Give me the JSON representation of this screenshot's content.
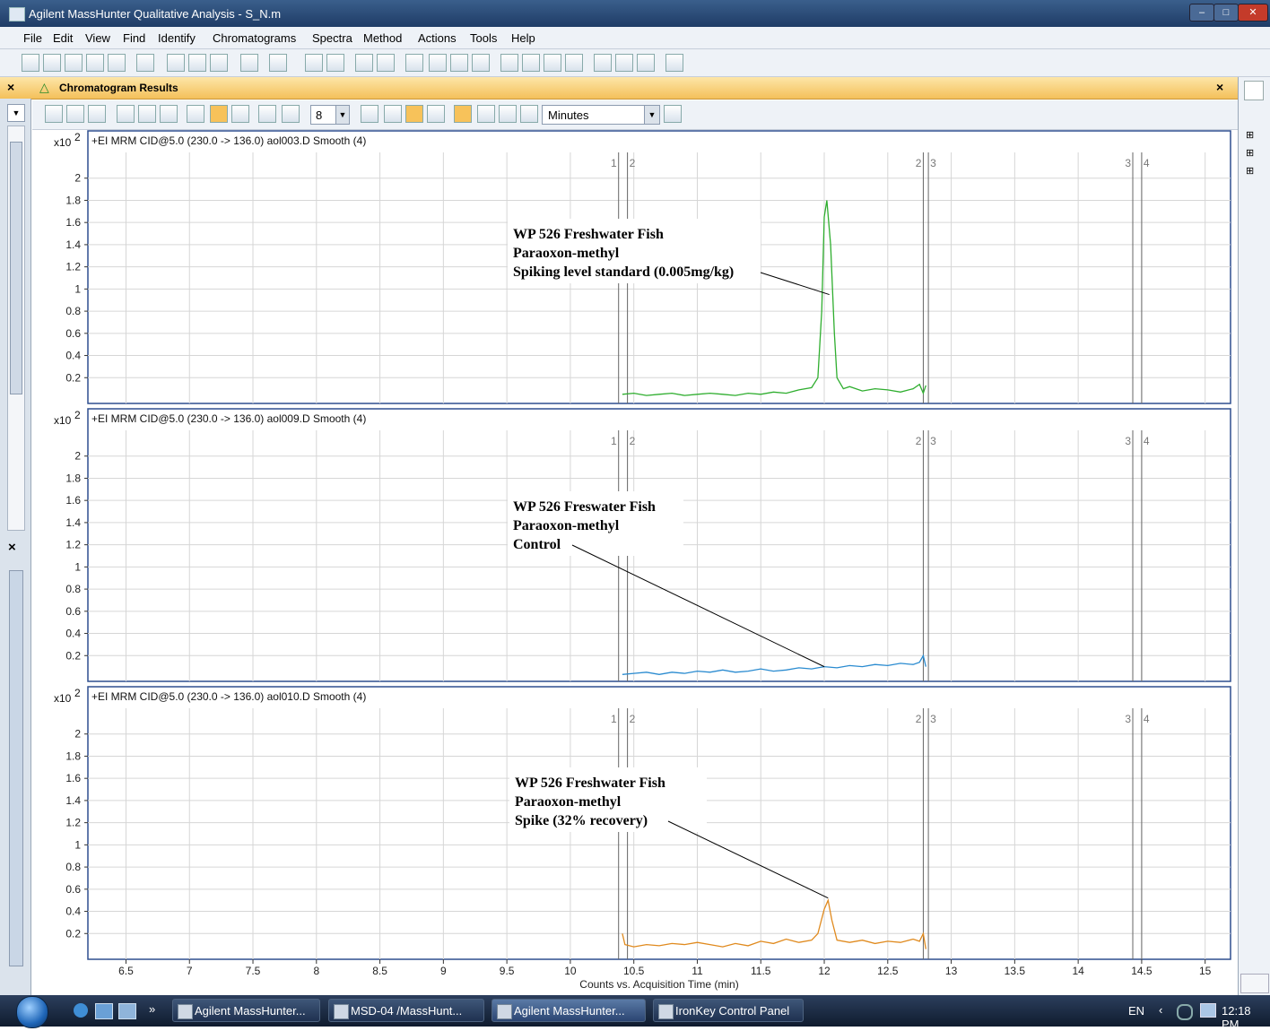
{
  "window": {
    "title": "Agilent MassHunter Qualitative Analysis - S_N.m"
  },
  "menu": [
    "File",
    "Edit",
    "View",
    "Find",
    "Identify",
    "Chromatograms",
    "Spectra",
    "Method",
    "Actions",
    "Tools",
    "Help"
  ],
  "panel": {
    "title": "Chromatogram Results",
    "close": "×"
  },
  "toolbar": {
    "smoothing_value": "8",
    "units": "Minutes"
  },
  "colors": {
    "green": "#2fae2f",
    "blue": "#2a8bd0",
    "orange": "#e08a1e",
    "border": "#2f4f8f"
  },
  "chart_data": [
    {
      "type": "line",
      "scale_label": "x10",
      "scale_exp": "2",
      "title": "+EI MRM CID@5.0 (230.0 -> 136.0) aol003.D  Smooth (4)",
      "ylim": [
        0,
        2.2
      ],
      "yticks": [
        2,
        1.8,
        1.6,
        1.4,
        1.2,
        1,
        0.8,
        0.6,
        0.4,
        0.2
      ],
      "segments": [
        "1",
        "2",
        "2",
        "3",
        "3",
        "4"
      ],
      "annotation": [
        "WP 526 Freshwater Fish",
        "Paraoxon-methyl",
        "Spiking level standard (0.005mg/kg)"
      ],
      "color": "#2fae2f",
      "series": [
        {
          "x": [
            10.41,
            10.5,
            10.6,
            10.7,
            10.8,
            10.9,
            11.0,
            11.1,
            11.2,
            11.3,
            11.4,
            11.5,
            11.6,
            11.7,
            11.8,
            11.9,
            11.95,
            11.98,
            12.0,
            12.02,
            12.05,
            12.08,
            12.1,
            12.15,
            12.2,
            12.3,
            12.4,
            12.5,
            12.6,
            12.7,
            12.75,
            12.78,
            12.8
          ],
          "y": [
            0.05,
            0.06,
            0.04,
            0.05,
            0.06,
            0.04,
            0.05,
            0.06,
            0.05,
            0.04,
            0.06,
            0.05,
            0.07,
            0.06,
            0.09,
            0.11,
            0.2,
            0.8,
            1.65,
            1.8,
            1.4,
            0.6,
            0.2,
            0.1,
            0.12,
            0.08,
            0.1,
            0.09,
            0.07,
            0.1,
            0.14,
            0.06,
            0.13
          ]
        }
      ]
    },
    {
      "type": "line",
      "scale_label": "x10",
      "scale_exp": "2",
      "title": "+EI MRM CID@5.0 (230.0 -> 136.0) aol009.D  Smooth (4)",
      "ylim": [
        0,
        2.2
      ],
      "yticks": [
        2,
        1.8,
        1.6,
        1.4,
        1.2,
        1,
        0.8,
        0.6,
        0.4,
        0.2
      ],
      "segments": [
        "1",
        "2",
        "2",
        "3",
        "3",
        "4"
      ],
      "annotation": [
        "WP 526 Freswater Fish",
        "Paraoxon-methyl",
        "Control"
      ],
      "color": "#2a8bd0",
      "series": [
        {
          "x": [
            10.41,
            10.5,
            10.6,
            10.7,
            10.8,
            10.9,
            11.0,
            11.1,
            11.2,
            11.3,
            11.4,
            11.5,
            11.6,
            11.7,
            11.8,
            11.9,
            12.0,
            12.1,
            12.2,
            12.3,
            12.4,
            12.5,
            12.6,
            12.7,
            12.75,
            12.78,
            12.8
          ],
          "y": [
            0.03,
            0.04,
            0.05,
            0.03,
            0.05,
            0.04,
            0.06,
            0.05,
            0.07,
            0.05,
            0.06,
            0.08,
            0.06,
            0.07,
            0.09,
            0.08,
            0.1,
            0.09,
            0.11,
            0.1,
            0.12,
            0.11,
            0.13,
            0.12,
            0.14,
            0.2,
            0.1
          ]
        }
      ]
    },
    {
      "type": "line",
      "scale_label": "x10",
      "scale_exp": "2",
      "title": "+EI MRM CID@5.0 (230.0 -> 136.0) aol010.D  Smooth (4)",
      "ylim": [
        0,
        2.2
      ],
      "yticks": [
        2,
        1.8,
        1.6,
        1.4,
        1.2,
        1,
        0.8,
        0.6,
        0.4,
        0.2
      ],
      "segments": [
        "1",
        "2",
        "2",
        "3",
        "3",
        "4"
      ],
      "annotation": [
        "WP 526 Freshwater Fish",
        "Paraoxon-methyl",
        "Spike (32% recovery)"
      ],
      "color": "#e08a1e",
      "xticks": [
        6.5,
        7,
        7.5,
        8,
        8.5,
        9,
        9.5,
        10,
        10.5,
        11,
        11.5,
        12,
        12.5,
        13,
        13.5,
        14,
        14.5,
        15
      ],
      "xlabel": "Counts vs. Acquisition Time (min)",
      "series": [
        {
          "x": [
            10.41,
            10.43,
            10.5,
            10.6,
            10.7,
            10.8,
            10.9,
            11.0,
            11.1,
            11.2,
            11.3,
            11.4,
            11.5,
            11.6,
            11.7,
            11.8,
            11.9,
            11.95,
            12.0,
            12.03,
            12.06,
            12.1,
            12.2,
            12.3,
            12.4,
            12.5,
            12.6,
            12.7,
            12.75,
            12.78,
            12.8
          ],
          "y": [
            0.2,
            0.1,
            0.08,
            0.1,
            0.09,
            0.11,
            0.1,
            0.12,
            0.1,
            0.08,
            0.11,
            0.09,
            0.13,
            0.11,
            0.15,
            0.12,
            0.14,
            0.2,
            0.42,
            0.5,
            0.32,
            0.14,
            0.12,
            0.14,
            0.11,
            0.13,
            0.12,
            0.15,
            0.13,
            0.2,
            0.06
          ]
        }
      ]
    }
  ],
  "taskbar": {
    "items": [
      "Agilent MassHunter...",
      "MSD-04 /MassHunt...",
      "Agilent MassHunter...",
      "IronKey Control Panel"
    ],
    "lang": "EN",
    "time": "12:18 PM"
  }
}
